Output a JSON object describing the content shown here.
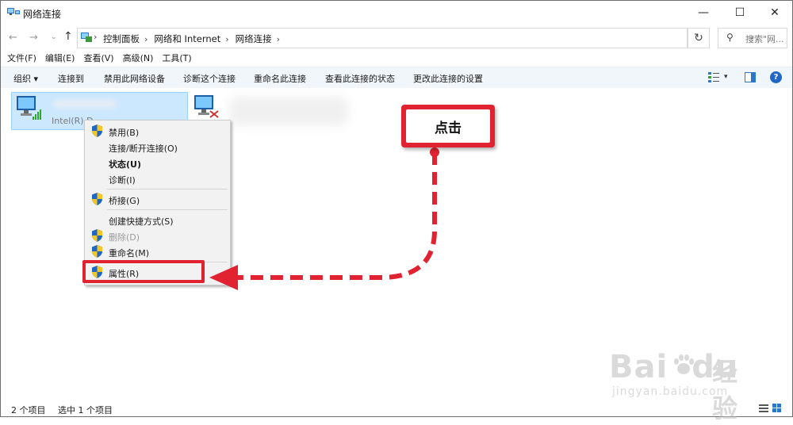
{
  "window": {
    "title": "网络连接",
    "min": "—",
    "max": "☐",
    "close": "✕"
  },
  "nav": {
    "back": "←",
    "forward": "→",
    "history": "⌄",
    "up": "↑"
  },
  "address": {
    "breadcrumbs": [
      "控制面板",
      "网络和 Internet",
      "网络连接"
    ],
    "separator": "›",
    "dropdown": "⌄",
    "refresh": "↻",
    "search_placeholder": "搜索\"网..."
  },
  "menubar": [
    "文件(F)",
    "编辑(E)",
    "查看(V)",
    "高级(N)",
    "工具(T)"
  ],
  "commandbar": {
    "organize": "组织 ▾",
    "items": [
      "连接到",
      "禁用此网络设备",
      "诊断这个连接",
      "重命名此连接",
      "查看此连接的状态",
      "更改此连接的设置"
    ],
    "view_dd": "▾",
    "help": "?"
  },
  "connections": [
    {
      "subtitle": "Intel(R) D"
    }
  ],
  "context_menu": [
    {
      "label": "禁用(B)",
      "shield": true
    },
    {
      "label": "连接/断开连接(O)",
      "shield": false
    },
    {
      "label": "状态(U)",
      "shield": false,
      "bold": true
    },
    {
      "label": "诊断(I)",
      "shield": false
    },
    {
      "label": "桥接(G)",
      "shield": true
    },
    {
      "label": "创建快捷方式(S)",
      "shield": false
    },
    {
      "label": "删除(D)",
      "shield": true,
      "disabled": true
    },
    {
      "label": "重命名(M)",
      "shield": true
    },
    {
      "label": "属性(R)",
      "shield": true
    }
  ],
  "annotation": {
    "callout_text": "点击",
    "color": "#e02231"
  },
  "watermark": {
    "brand": "Bai",
    "brand2": "du",
    "jingyan": "经验",
    "url": "jingyan.baidu.com"
  },
  "status": {
    "item_count": "2 个项目",
    "selected": "选中 1 个项目"
  },
  "colors": {
    "selection": "#cce8ff",
    "cmdbar": "#f1f6fb",
    "accent": "#1e66c8"
  }
}
